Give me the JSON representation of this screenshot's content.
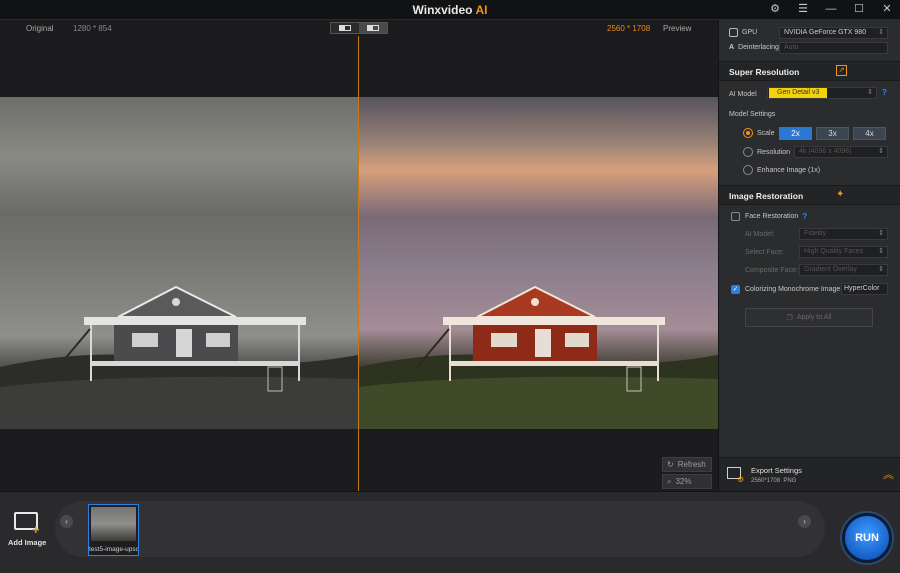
{
  "titlebar": {
    "brand": "Winxvideo",
    "brand_ai": "AI"
  },
  "topbar": {
    "original_label": "Original",
    "original_size": "1280 * 854",
    "preview_size": "2560 * 1708",
    "preview_label": "Preview"
  },
  "viewer": {
    "refresh_label": "Refresh",
    "zoom": "32%"
  },
  "panel": {
    "gpu_label": "GPU",
    "gpu_value": "NVIDIA GeForce GTX 980",
    "deinterlacing_label": "Deinterlacing",
    "deinterlacing_value": "Auto",
    "super_resolution": {
      "title": "Super Resolution",
      "ai_model_label": "AI Model",
      "ai_model_value": "Gen Detail v3",
      "model_settings_label": "Model Settings",
      "scale_label": "Scale",
      "scale_options": [
        "2x",
        "3x",
        "4x"
      ],
      "resolution_label": "Resolution",
      "resolution_value": "4k (4096 x 4096)",
      "enhance_label": "Enhance Image (1x)"
    },
    "image_restoration": {
      "title": "Image Restoration",
      "face_restoration_label": "Face Restoration",
      "ai_model_label": "AI Model:",
      "ai_model_value": "Fidelity",
      "select_face_label": "Select Face:",
      "select_face_value": "High Quality Faces",
      "composite_face_label": "Composite Face:",
      "composite_face_value": "Gradient Overlay",
      "colorizing_label": "Colorizing Monochrome Image:",
      "colorizing_value": "HyperColor",
      "apply_all_label": "Apply to All"
    },
    "export": {
      "title": "Export Settings",
      "info": "2560*1708  PNG"
    }
  },
  "bottom": {
    "add_image_label": "Add Image",
    "thumb_caption": "test5-image-upsc",
    "run_label": "RUN"
  }
}
